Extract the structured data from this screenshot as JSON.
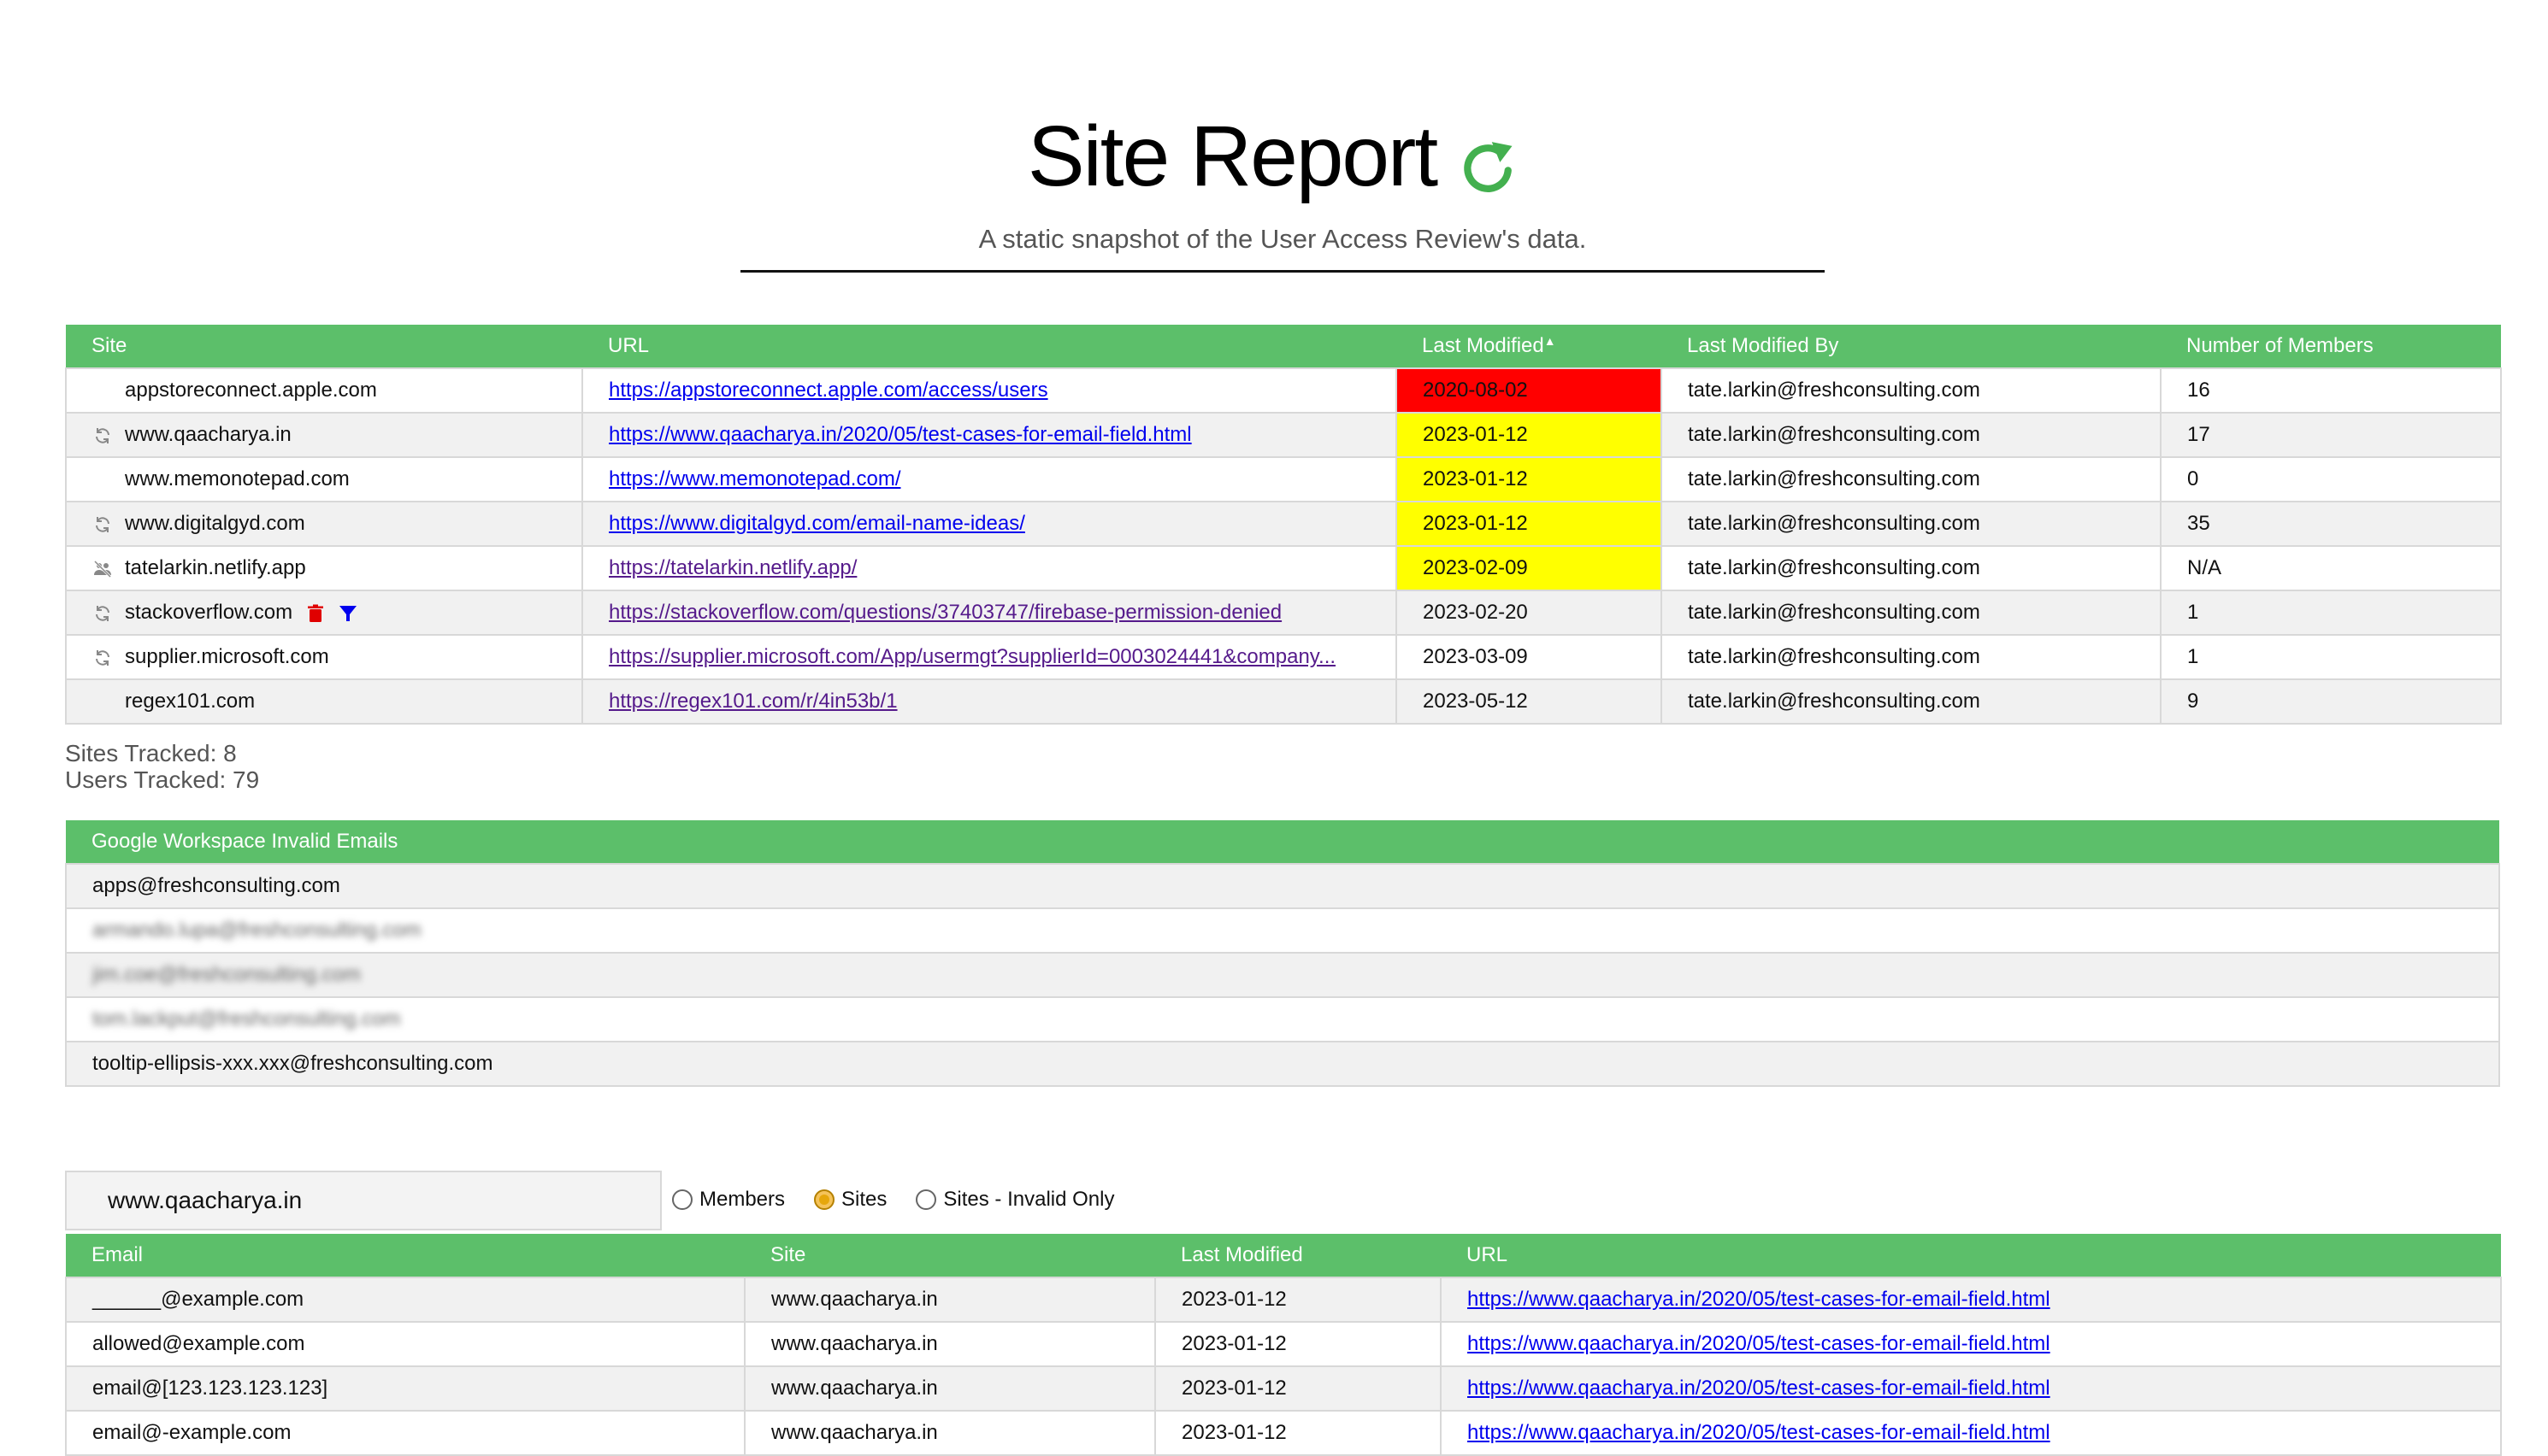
{
  "header": {
    "title": "Site Report",
    "subtitle": "A static snapshot of the User Access Review's data."
  },
  "colors": {
    "accent": "#5cbf6a",
    "stale": "#ff0000",
    "warning": "#ffff00"
  },
  "sites_table": {
    "columns": [
      "Site",
      "URL",
      "Last Modified",
      "Last Modified By",
      "Number of Members"
    ],
    "sort_indicator": "Last Modified ascending",
    "rows": [
      {
        "icon": "",
        "site": "appstoreconnect.apple.com",
        "url": "https://appstoreconnect.apple.com/access/users",
        "last_modified": "2020-08-02",
        "last_modified_by": "tate.larkin@freshconsulting.com",
        "members": "16",
        "status": "red"
      },
      {
        "icon": "sync-icon",
        "site": "www.qaacharya.in",
        "url": "https://www.qaacharya.in/2020/05/test-cases-for-email-field.html",
        "last_modified": "2023-01-12",
        "last_modified_by": "tate.larkin@freshconsulting.com",
        "members": "17",
        "status": "yellow"
      },
      {
        "icon": "",
        "site": "www.memonotepad.com",
        "url": "https://www.memonotepad.com/",
        "last_modified": "2023-01-12",
        "last_modified_by": "tate.larkin@freshconsulting.com",
        "members": "0",
        "status": "yellow"
      },
      {
        "icon": "sync-icon",
        "site": "www.digitalgyd.com",
        "url": "https://www.digitalgyd.com/email-name-ideas/",
        "last_modified": "2023-01-12",
        "last_modified_by": "tate.larkin@freshconsulting.com",
        "members": "35",
        "status": "yellow"
      },
      {
        "icon": "users-off-icon",
        "site": "tatelarkin.netlify.app",
        "url": "https://tatelarkin.netlify.app/",
        "last_modified": "2023-02-09",
        "last_modified_by": "tate.larkin@freshconsulting.com",
        "members": "N/A",
        "status": "yellow"
      },
      {
        "icon": "sync-icon",
        "site": "stackoverflow.com",
        "url": "https://stackoverflow.com/questions/37403747/firebase-permission-denied",
        "last_modified": "2023-02-20",
        "last_modified_by": "tate.larkin@freshconsulting.com",
        "members": "1",
        "status": "",
        "extra_icons": [
          "trash-icon",
          "filter-icon"
        ]
      },
      {
        "icon": "sync-icon",
        "site": "supplier.microsoft.com",
        "url": "https://supplier.microsoft.com/App/usermgt?supplierId=0003024441&company...",
        "last_modified": "2023-03-09",
        "last_modified_by": "tate.larkin@freshconsulting.com",
        "members": "1",
        "status": ""
      },
      {
        "icon": "",
        "site": "regex101.com",
        "url": "https://regex101.com/r/4in53b/1",
        "last_modified": "2023-05-12",
        "last_modified_by": "tate.larkin@freshconsulting.com",
        "members": "9",
        "status": ""
      }
    ]
  },
  "stats": {
    "sites_tracked": "Sites Tracked: 8",
    "users_tracked": "Users Tracked: 79"
  },
  "invalid_emails": {
    "header": "Google Workspace Invalid Emails",
    "rows": [
      {
        "email": "apps@freshconsulting.com",
        "blurred": false
      },
      {
        "email": "armando.lupa@freshconsulting.com",
        "blurred": true
      },
      {
        "email": "jim.coe@freshconsulting.com",
        "blurred": true
      },
      {
        "email": "tom.lackput@freshconsulting.com",
        "blurred": true
      },
      {
        "email": "tooltip-ellipsis-xxx.xxx@freshconsulting.com",
        "blurred": false
      }
    ]
  },
  "filter": {
    "search_value": "www.qaacharya.in",
    "options": [
      "Members",
      "Sites",
      "Sites - Invalid Only"
    ],
    "selected": "Sites"
  },
  "members_table": {
    "columns": [
      "Email",
      "Site",
      "Last Modified",
      "URL"
    ],
    "rows": [
      {
        "email": "______@example.com",
        "site": "www.qaacharya.in",
        "last_modified": "2023-01-12",
        "url": "https://www.qaacharya.in/2020/05/test-cases-for-email-field.html"
      },
      {
        "email": "allowed@example.com",
        "site": "www.qaacharya.in",
        "last_modified": "2023-01-12",
        "url": "https://www.qaacharya.in/2020/05/test-cases-for-email-field.html"
      },
      {
        "email": "email@[123.123.123.123]",
        "site": "www.qaacharya.in",
        "last_modified": "2023-01-12",
        "url": "https://www.qaacharya.in/2020/05/test-cases-for-email-field.html"
      },
      {
        "email": "email@-example.com",
        "site": "www.qaacharya.in",
        "last_modified": "2023-01-12",
        "url": "https://www.qaacharya.in/2020/05/test-cases-for-email-field.html"
      }
    ]
  }
}
